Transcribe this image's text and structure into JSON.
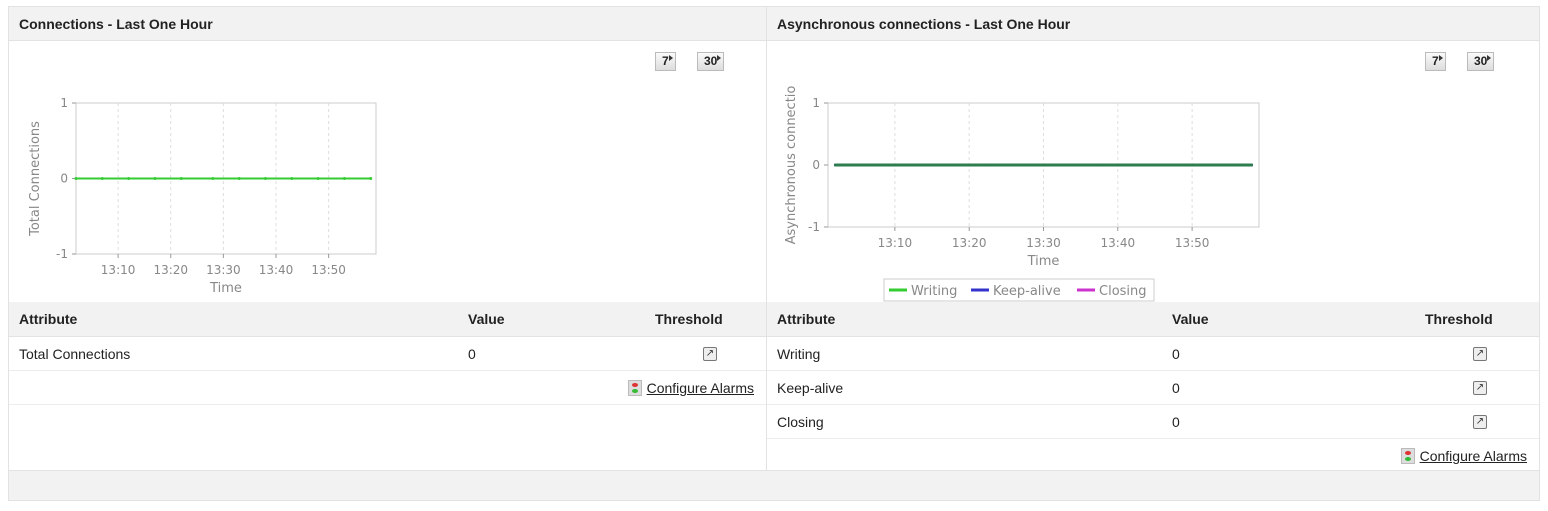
{
  "left": {
    "title": "Connections - Last One Hour",
    "btn7": "7",
    "btn30": "30",
    "table": {
      "headers": [
        "Attribute",
        "Value",
        "Threshold"
      ],
      "rows": [
        {
          "attribute": "Total Connections",
          "value": "0"
        }
      ]
    },
    "configure_alarms": "Configure Alarms"
  },
  "right": {
    "title": "Asynchronous connections - Last One Hour",
    "btn7": "7",
    "btn30": "30",
    "table": {
      "headers": [
        "Attribute",
        "Value",
        "Threshold"
      ],
      "rows": [
        {
          "attribute": "Writing",
          "value": "0"
        },
        {
          "attribute": "Keep-alive",
          "value": "0"
        },
        {
          "attribute": "Closing",
          "value": "0"
        }
      ]
    },
    "configure_alarms": "Configure Alarms"
  },
  "chart_data": [
    {
      "type": "line",
      "title": "Connections - Last One Hour",
      "xlabel": "Time",
      "ylabel": "Total Connections",
      "ylim": [
        -1,
        1
      ],
      "yticks": [
        "1",
        "0",
        "-1"
      ],
      "xticks": [
        "13:10",
        "13:20",
        "13:30",
        "13:40",
        "13:50"
      ],
      "xlim": [
        "13:02",
        "13:59"
      ],
      "x": [
        "13:02",
        "13:07",
        "13:12",
        "13:17",
        "13:22",
        "13:28",
        "13:33",
        "13:38",
        "13:43",
        "13:48",
        "13:53",
        "13:58"
      ],
      "series": [
        {
          "name": "Total Connections",
          "color": "#33cc33",
          "values": [
            0,
            0,
            0,
            0,
            0,
            0,
            0,
            0,
            0,
            0,
            0,
            0
          ]
        }
      ],
      "legend": "none",
      "grid": true
    },
    {
      "type": "line",
      "title": "Asynchronous connections - Last One Hour",
      "xlabel": "Time",
      "ylabel": "Asynchronous connectio",
      "ylim": [
        -1,
        1
      ],
      "yticks": [
        "1",
        "0",
        "-1"
      ],
      "xticks": [
        "13:10",
        "13:20",
        "13:30",
        "13:40",
        "13:50"
      ],
      "xlim": [
        "13:01",
        "13:59"
      ],
      "x": [
        "13:02",
        "13:07",
        "13:12",
        "13:17",
        "13:22",
        "13:28",
        "13:33",
        "13:38",
        "13:43",
        "13:48",
        "13:53",
        "13:58"
      ],
      "series": [
        {
          "name": "Writing",
          "color": "#33cc33",
          "values": [
            0,
            0,
            0,
            0,
            0,
            0,
            0,
            0,
            0,
            0,
            0,
            0
          ]
        },
        {
          "name": "Keep-alive",
          "color": "#3333cc",
          "values": [
            0,
            0,
            0,
            0,
            0,
            0,
            0,
            0,
            0,
            0,
            0,
            0
          ]
        },
        {
          "name": "Closing",
          "color": "#cc33cc",
          "values": [
            0,
            0,
            0,
            0,
            0,
            0,
            0,
            0,
            0,
            0,
            0,
            0
          ]
        }
      ],
      "legend": "bottom",
      "grid": true
    }
  ]
}
